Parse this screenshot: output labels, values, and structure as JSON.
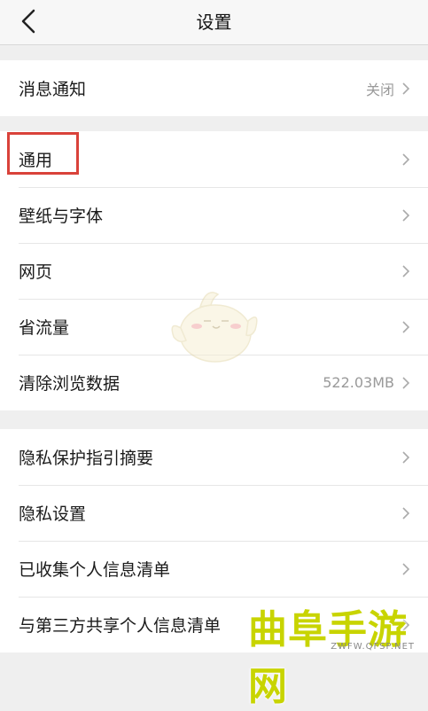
{
  "header": {
    "title": "设置",
    "back_icon": "chevron-left-icon"
  },
  "groups": [
    {
      "rows": [
        {
          "label": "消息通知",
          "value": "关闭"
        }
      ]
    },
    {
      "rows": [
        {
          "label": "通用",
          "value": ""
        },
        {
          "label": "壁纸与字体",
          "value": ""
        },
        {
          "label": "网页",
          "value": ""
        },
        {
          "label": "省流量",
          "value": ""
        },
        {
          "label": "清除浏览数据",
          "value": "522.03MB"
        }
      ]
    },
    {
      "rows": [
        {
          "label": "隐私保护指引摘要",
          "value": ""
        },
        {
          "label": "隐私设置",
          "value": ""
        },
        {
          "label": "已收集个人信息清单",
          "value": ""
        },
        {
          "label": "与第三方共享个人信息清单",
          "value": ""
        }
      ]
    }
  ],
  "watermark": {
    "text": "曲阜手游网",
    "url": "ZWFW.QFSP.NET"
  },
  "colors": {
    "highlight": "#d9423a",
    "watermark": "#c8d400"
  }
}
